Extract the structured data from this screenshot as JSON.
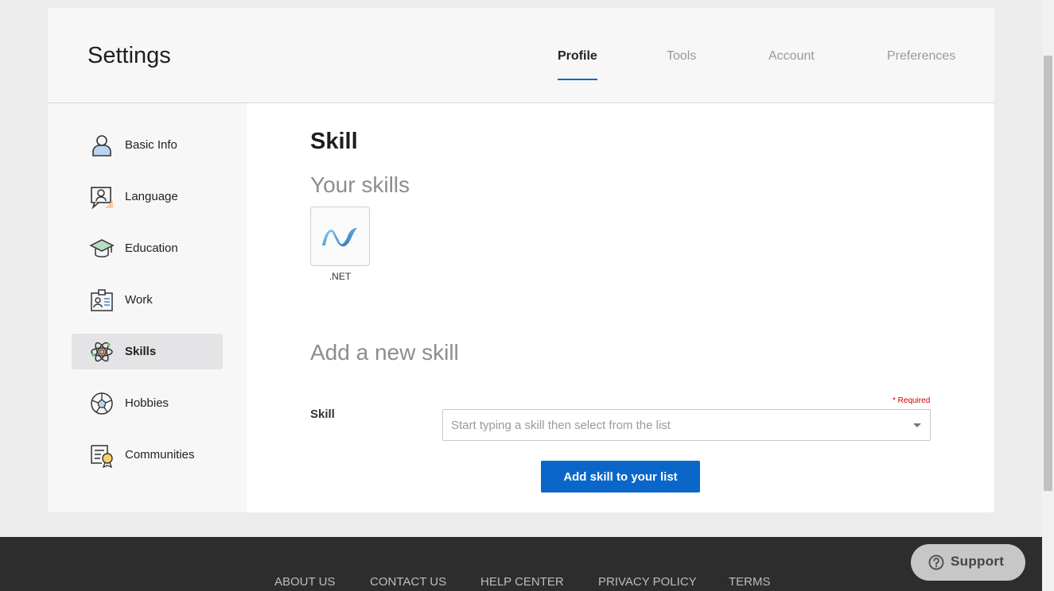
{
  "header": {
    "title": "Settings",
    "tabs": [
      {
        "label": "Profile",
        "active": true
      },
      {
        "label": "Tools",
        "active": false
      },
      {
        "label": "Account",
        "active": false
      },
      {
        "label": "Preferences",
        "active": false
      }
    ]
  },
  "sidebar": {
    "items": [
      {
        "label": "Basic Info",
        "icon": "person-icon",
        "active": false
      },
      {
        "label": "Language",
        "icon": "speech-bubble-icon",
        "active": false
      },
      {
        "label": "Education",
        "icon": "graduation-cap-icon",
        "active": false
      },
      {
        "label": "Work",
        "icon": "id-badge-icon",
        "active": false
      },
      {
        "label": "Skills",
        "icon": "atom-icon",
        "active": true
      },
      {
        "label": "Hobbies",
        "icon": "soccer-ball-icon",
        "active": false
      },
      {
        "label": "Communities",
        "icon": "certificate-icon",
        "active": false
      }
    ]
  },
  "main": {
    "section_title": "Skill",
    "your_skills_title": "Your skills",
    "skills": [
      {
        "label": ".NET",
        "icon": "dotnet-logo-icon"
      }
    ],
    "add_title": "Add a new skill",
    "field_label": "Skill",
    "required_text": "* Required",
    "input_placeholder": "Start typing a skill then select from the list",
    "input_value": "",
    "add_button_label": "Add skill to your list"
  },
  "footer": {
    "links": [
      "ABOUT US",
      "CONTACT US",
      "HELP CENTER",
      "PRIVACY POLICY",
      "TERMS"
    ]
  },
  "support": {
    "label": "Support",
    "icon": "question-circle-icon"
  },
  "colors": {
    "accent": "#0a67c9",
    "required": "#cc0000",
    "footer_bg": "#2d2d2d",
    "page_bg": "#ececec"
  }
}
